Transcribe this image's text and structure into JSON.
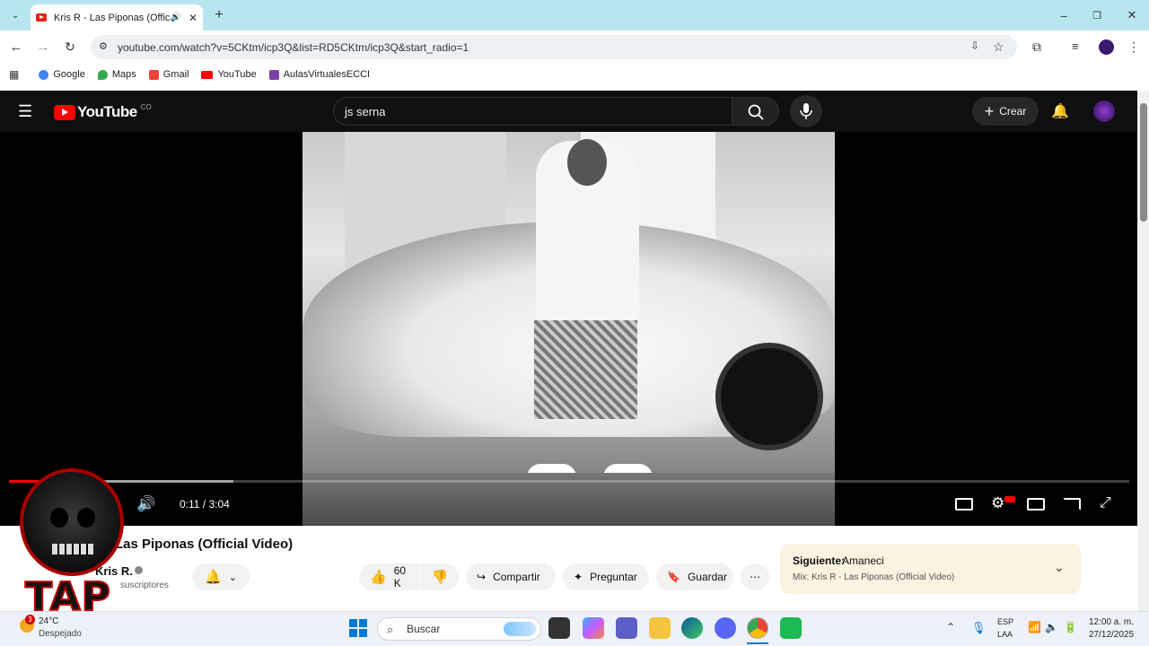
{
  "browser": {
    "tab_title": "Kris R - Las Piponas (Officia",
    "url": "youtube.com/watch?v=5CKtm/icp3Q&list=RD5CKtm/icp3Q&start_radio=1",
    "bookmarks": [
      {
        "label": "Google",
        "color": "#4285f4"
      },
      {
        "label": "Maps",
        "color": "#34a853"
      },
      {
        "label": "Gmail",
        "color": "#ea4335"
      },
      {
        "label": "YouTube",
        "color": "#ff0000"
      },
      {
        "label": "AulasVirtualesECCI",
        "color": "#7b3fa8"
      }
    ]
  },
  "youtube": {
    "logo_text": "YouTube",
    "country_code": "CO",
    "search_value": "js serna",
    "create_label": "Crear",
    "player": {
      "time_display": "0:11 / 3:04",
      "progress_fraction": 0.06,
      "buffered_fraction": 0.2
    },
    "video_title": "Las Piponas (Official Video)",
    "channel": "Kris R.",
    "subscribers": "suscriptores",
    "likes": "60 K",
    "share_label": "Compartir",
    "ask_label": "Preguntar",
    "save_label": "Guardar",
    "next": {
      "label": "Siguiente:",
      "title": "Amaneci",
      "mix": "Mix: Kris R - Las Piponas (Official Video)"
    }
  },
  "overlay": {
    "logo_text": "TAP"
  },
  "taskbar": {
    "weather_temp": "24°C",
    "weather_desc": "Despejado",
    "search_placeholder": "Buscar",
    "lang_top": "ESP",
    "lang_bottom": "LAA",
    "time": "12:00 a. m.",
    "date": "27/12/2025",
    "notif_count": "3"
  }
}
